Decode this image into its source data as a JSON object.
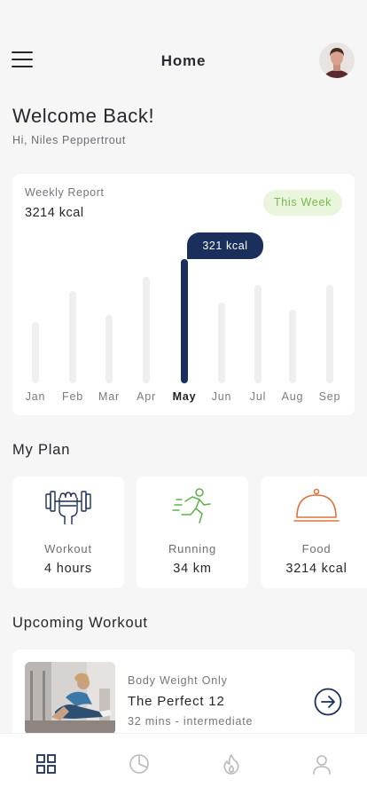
{
  "header": {
    "title": "Home",
    "menu_icon": "hamburger-menu-icon",
    "avatar": "user-avatar"
  },
  "welcome": {
    "title": "Welcome Back!",
    "greeting": "Hi, Niles Peppertrout"
  },
  "weekly_report": {
    "label": "Weekly Report",
    "value": "3214 kcal",
    "badge": "This Week",
    "tooltip": "321 kcal",
    "active_month": "May",
    "colors": {
      "active_bar": "#1b2f5c",
      "inactive_bar": "#efeff1",
      "badge_text": "#7ab84a",
      "badge_bg": "#e9f5dd"
    },
    "chart_data": {
      "type": "bar",
      "categories": [
        "Jan",
        "Feb",
        "Mar",
        "Apr",
        "May",
        "Jun",
        "Jul",
        "Aug",
        "Sep"
      ],
      "values": [
        0.49,
        0.74,
        0.55,
        0.86,
        1.0,
        0.65,
        0.79,
        0.59,
        0.79
      ],
      "highlighted": "May",
      "grid": false
    }
  },
  "my_plan": {
    "title": "My Plan",
    "cards": [
      {
        "icon": "dumbbell-fist-icon",
        "label": "Workout",
        "value": "4 hours",
        "color": "#1b2f5c"
      },
      {
        "icon": "running-person-icon",
        "label": "Running",
        "value": "34 km",
        "color": "#5fb04a"
      },
      {
        "icon": "food-cloche-icon",
        "label": "Food",
        "value": "3214 kcal",
        "color": "#e2703a"
      }
    ]
  },
  "upcoming_workout": {
    "title": "Upcoming Workout",
    "category": "Body Weight Only",
    "name": "The Perfect 12",
    "meta": "32 mins - intermediate",
    "thumbnail": "woman-stretching-photo",
    "action_icon": "arrow-right-circle-icon"
  },
  "tabbar": {
    "items": [
      {
        "icon": "grid-home-icon",
        "active": true
      },
      {
        "icon": "pie-chart-icon",
        "active": false
      },
      {
        "icon": "flame-icon",
        "active": false
      },
      {
        "icon": "profile-icon",
        "active": false
      }
    ]
  }
}
